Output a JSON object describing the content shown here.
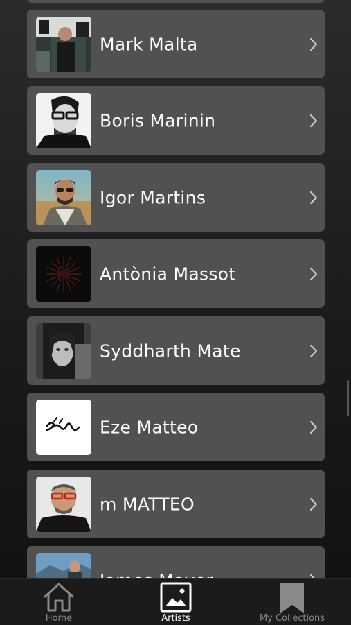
{
  "artists": [
    {
      "name": "Mark Malta"
    },
    {
      "name": "Boris Marinin"
    },
    {
      "name": "Igor Martins"
    },
    {
      "name": "Antònia Massot"
    },
    {
      "name": "Syddharth Mate"
    },
    {
      "name": "Eze Matteo"
    },
    {
      "name": "m MATTEO"
    },
    {
      "name": "James Mayer"
    }
  ],
  "tabbar": {
    "home": "Home",
    "artists": "Artists",
    "collections": "My Collections",
    "active": "artists"
  },
  "colors": {
    "row_bg": "#515151",
    "text": "#ffffff",
    "tab_inactive": "#8a8a8a"
  }
}
